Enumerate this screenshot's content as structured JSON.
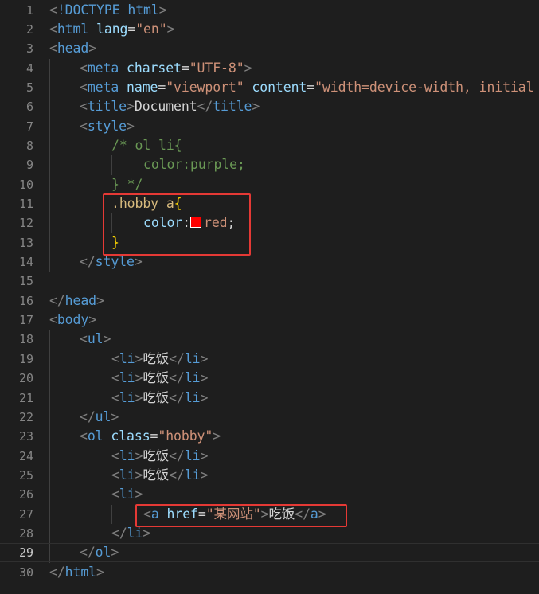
{
  "editor": {
    "language": "html",
    "current_line": "29",
    "lines": [
      {
        "no": "1",
        "tokens": [
          [
            "brk",
            "<"
          ],
          [
            "tag",
            "!DOCTYPE "
          ],
          [
            "tag",
            "html"
          ],
          [
            "brk",
            ">"
          ]
        ]
      },
      {
        "no": "2",
        "tokens": [
          [
            "brk",
            "<"
          ],
          [
            "tag",
            "html"
          ],
          [
            "text",
            " "
          ],
          [
            "attr",
            "lang"
          ],
          [
            "text",
            "="
          ],
          [
            "str",
            "\"en\""
          ],
          [
            "brk",
            ">"
          ]
        ]
      },
      {
        "no": "3",
        "tokens": [
          [
            "brk",
            "<"
          ],
          [
            "tag",
            "head"
          ],
          [
            "brk",
            ">"
          ]
        ]
      },
      {
        "no": "4",
        "tokens": [
          [
            "brk",
            "<"
          ],
          [
            "tag",
            "meta"
          ],
          [
            "text",
            " "
          ],
          [
            "attr",
            "charset"
          ],
          [
            "text",
            "="
          ],
          [
            "str",
            "\"UTF-8\""
          ],
          [
            "brk",
            ">"
          ]
        ]
      },
      {
        "no": "5",
        "tokens": [
          [
            "brk",
            "<"
          ],
          [
            "tag",
            "meta"
          ],
          [
            "text",
            " "
          ],
          [
            "attr",
            "name"
          ],
          [
            "text",
            "="
          ],
          [
            "str",
            "\"viewport\""
          ],
          [
            "text",
            " "
          ],
          [
            "attr",
            "content"
          ],
          [
            "text",
            "="
          ],
          [
            "str",
            "\"width=device-width, initial"
          ]
        ]
      },
      {
        "no": "6",
        "tokens": [
          [
            "brk",
            "<"
          ],
          [
            "tag",
            "title"
          ],
          [
            "brk",
            ">"
          ],
          [
            "text",
            "Document"
          ],
          [
            "brk",
            "</"
          ],
          [
            "tag",
            "title"
          ],
          [
            "brk",
            ">"
          ]
        ]
      },
      {
        "no": "7",
        "tokens": [
          [
            "brk",
            "<"
          ],
          [
            "tag",
            "style"
          ],
          [
            "brk",
            ">"
          ]
        ]
      },
      {
        "no": "8",
        "tokens": [
          [
            "com",
            "/* ol li{"
          ]
        ]
      },
      {
        "no": "9",
        "tokens": [
          [
            "com",
            "color:purple;"
          ]
        ]
      },
      {
        "no": "10",
        "tokens": [
          [
            "com",
            "} */"
          ]
        ]
      },
      {
        "no": "11",
        "tokens": [
          [
            "sel",
            ".hobby a"
          ],
          [
            "brace",
            "{"
          ]
        ]
      },
      {
        "no": "12",
        "tokens": [
          [
            "prop",
            "color"
          ],
          [
            "text",
            ":"
          ],
          [
            "swatch",
            ""
          ],
          [
            "val",
            "red"
          ],
          [
            "text",
            ";"
          ]
        ]
      },
      {
        "no": "13",
        "tokens": [
          [
            "brace",
            "}"
          ]
        ]
      },
      {
        "no": "14",
        "tokens": [
          [
            "brk",
            "</"
          ],
          [
            "tag",
            "style"
          ],
          [
            "brk",
            ">"
          ]
        ]
      },
      {
        "no": "15",
        "tokens": []
      },
      {
        "no": "16",
        "tokens": [
          [
            "brk",
            "</"
          ],
          [
            "tag",
            "head"
          ],
          [
            "brk",
            ">"
          ]
        ]
      },
      {
        "no": "17",
        "tokens": [
          [
            "brk",
            "<"
          ],
          [
            "tag",
            "body"
          ],
          [
            "brk",
            ">"
          ]
        ]
      },
      {
        "no": "18",
        "tokens": [
          [
            "brk",
            "<"
          ],
          [
            "tag",
            "ul"
          ],
          [
            "brk",
            ">"
          ]
        ]
      },
      {
        "no": "19",
        "tokens": [
          [
            "brk",
            "<"
          ],
          [
            "tag",
            "li"
          ],
          [
            "brk",
            ">"
          ],
          [
            "text",
            "吃饭"
          ],
          [
            "brk",
            "</"
          ],
          [
            "tag",
            "li"
          ],
          [
            "brk",
            ">"
          ]
        ]
      },
      {
        "no": "20",
        "tokens": [
          [
            "brk",
            "<"
          ],
          [
            "tag",
            "li"
          ],
          [
            "brk",
            ">"
          ],
          [
            "text",
            "吃饭"
          ],
          [
            "brk",
            "</"
          ],
          [
            "tag",
            "li"
          ],
          [
            "brk",
            ">"
          ]
        ]
      },
      {
        "no": "21",
        "tokens": [
          [
            "brk",
            "<"
          ],
          [
            "tag",
            "li"
          ],
          [
            "brk",
            ">"
          ],
          [
            "text",
            "吃饭"
          ],
          [
            "brk",
            "</"
          ],
          [
            "tag",
            "li"
          ],
          [
            "brk",
            ">"
          ]
        ]
      },
      {
        "no": "22",
        "tokens": [
          [
            "brk",
            "</"
          ],
          [
            "tag",
            "ul"
          ],
          [
            "brk",
            ">"
          ]
        ]
      },
      {
        "no": "23",
        "tokens": [
          [
            "brk",
            "<"
          ],
          [
            "tag",
            "ol"
          ],
          [
            "text",
            " "
          ],
          [
            "attr",
            "class"
          ],
          [
            "text",
            "="
          ],
          [
            "str",
            "\"hobby\""
          ],
          [
            "brk",
            ">"
          ]
        ]
      },
      {
        "no": "24",
        "tokens": [
          [
            "brk",
            "<"
          ],
          [
            "tag",
            "li"
          ],
          [
            "brk",
            ">"
          ],
          [
            "text",
            "吃饭"
          ],
          [
            "brk",
            "</"
          ],
          [
            "tag",
            "li"
          ],
          [
            "brk",
            ">"
          ]
        ]
      },
      {
        "no": "25",
        "tokens": [
          [
            "brk",
            "<"
          ],
          [
            "tag",
            "li"
          ],
          [
            "brk",
            ">"
          ],
          [
            "text",
            "吃饭"
          ],
          [
            "brk",
            "</"
          ],
          [
            "tag",
            "li"
          ],
          [
            "brk",
            ">"
          ]
        ]
      },
      {
        "no": "26",
        "tokens": [
          [
            "brk",
            "<"
          ],
          [
            "tag",
            "li"
          ],
          [
            "brk",
            ">"
          ]
        ]
      },
      {
        "no": "27",
        "tokens": [
          [
            "brk",
            "<"
          ],
          [
            "tag",
            "a"
          ],
          [
            "text",
            " "
          ],
          [
            "attr",
            "href"
          ],
          [
            "text",
            "="
          ],
          [
            "str",
            "\"某网站\""
          ],
          [
            "brk",
            ">"
          ],
          [
            "text",
            "吃饭"
          ],
          [
            "brk",
            "</"
          ],
          [
            "tag",
            "a"
          ],
          [
            "brk",
            ">"
          ]
        ]
      },
      {
        "no": "28",
        "tokens": [
          [
            "brk",
            "</"
          ],
          [
            "tag",
            "li"
          ],
          [
            "brk",
            ">"
          ]
        ]
      },
      {
        "no": "29",
        "tokens": [
          [
            "brk",
            "</"
          ],
          [
            "tag",
            "ol"
          ],
          [
            "brk",
            ">"
          ]
        ]
      },
      {
        "no": "30",
        "tokens": [
          [
            "brk",
            "</"
          ],
          [
            "tag",
            "html"
          ],
          [
            "brk",
            ">"
          ]
        ]
      }
    ]
  }
}
